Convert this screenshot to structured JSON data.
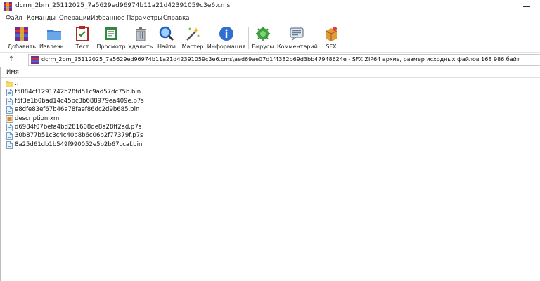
{
  "window": {
    "title": "dcrm_2bm_25112025_7a5629ed96974b11a21d42391059c3e6.cms"
  },
  "menu": [
    "Файл",
    "Команды",
    "Операции",
    "Избранное",
    "Параметры",
    "Справка"
  ],
  "toolbar": [
    {
      "label": "Добавить",
      "icon": "add-archive-icon"
    },
    {
      "label": "Извлечь...",
      "icon": "extract-folder-icon"
    },
    {
      "label": "Тест",
      "icon": "test-clipboard-icon"
    },
    {
      "label": "Просмотр",
      "icon": "view-book-icon"
    },
    {
      "label": "Удалить",
      "icon": "trash-icon"
    },
    {
      "label": "Найти",
      "icon": "magnifier-icon"
    },
    {
      "label": "Мастер",
      "icon": "wizard-wand-icon"
    },
    {
      "label": "Информация",
      "icon": "info-icon"
    },
    {
      "label": "Вирусы",
      "icon": "virus-scan-icon"
    },
    {
      "label": "Комментарий",
      "icon": "comment-icon"
    },
    {
      "label": "SFX",
      "icon": "sfx-box-icon"
    }
  ],
  "address": {
    "up_symbol": "↑",
    "path": "dcrm_2bm_25112025_7a5629ed96974b11a21d42391059c3e6.cms\\aed69ae07d1f4382b69d3bb47948624e - SFX ZIP64 архив, размер исходных файлов 168 986 байт"
  },
  "file_list": {
    "column_name": "Имя",
    "rows": [
      {
        "name": "..",
        "type": "parent-folder"
      },
      {
        "name": "f5084cf1291742b28fd51c9ad57dc75b.bin",
        "type": "file"
      },
      {
        "name": "f5f3e1b0bad14c45bc3b688979ea409e.p7s",
        "type": "file"
      },
      {
        "name": "e8dfe83ef67b46a78faef86dc2d9b685.bin",
        "type": "file"
      },
      {
        "name": "description.xml",
        "type": "xml"
      },
      {
        "name": "d6984f07befa4bd281608de8a28ff2ad.p7s",
        "type": "file"
      },
      {
        "name": "30b877b51c3c4c40b8b6c06b2f77379f.p7s",
        "type": "file"
      },
      {
        "name": "8a25d61db1b549f990052e5b2b67ccaf.bin",
        "type": "file"
      }
    ]
  }
}
